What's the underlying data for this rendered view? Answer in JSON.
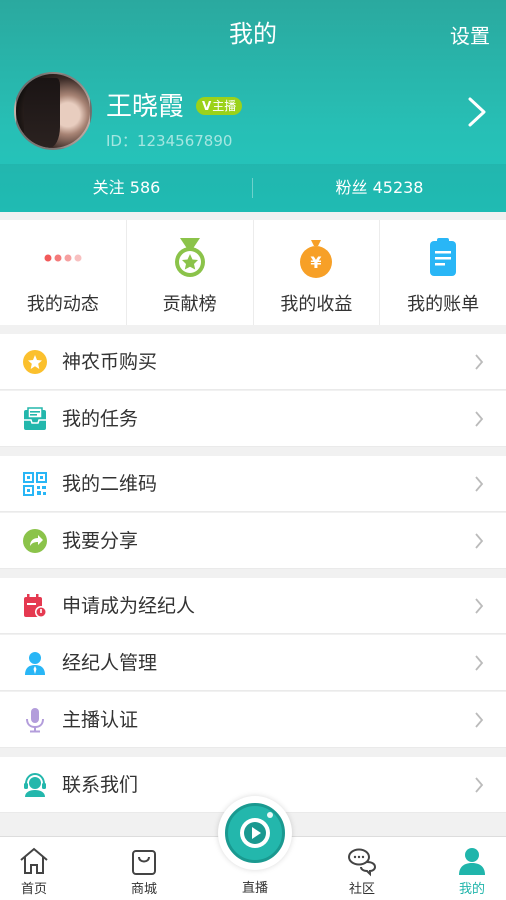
{
  "header": {
    "title": "我的",
    "settings_label": "设置"
  },
  "profile": {
    "name": "王晓霞",
    "badge_label": "主播",
    "badge_prefix": "V",
    "id_text": "ID：1234567890"
  },
  "stats": {
    "follow": "关注  586",
    "fans": "粉丝  45238"
  },
  "quick_actions": [
    {
      "label": "我的动态",
      "icon": "dots-icon"
    },
    {
      "label": "贡献榜",
      "icon": "medal-icon"
    },
    {
      "label": "我的收益",
      "icon": "money-bag-icon"
    },
    {
      "label": "我的账单",
      "icon": "clipboard-icon"
    }
  ],
  "menu": [
    {
      "label": "神农币购买",
      "icon": "coin-star-icon"
    },
    {
      "label": "我的任务",
      "icon": "task-tray-icon"
    },
    {
      "label": "我的二维码",
      "icon": "qr-code-icon"
    },
    {
      "label": "我要分享",
      "icon": "share-icon"
    },
    {
      "label": "申请成为经纪人",
      "icon": "calendar-apply-icon"
    },
    {
      "label": "经纪人管理",
      "icon": "person-manage-icon"
    },
    {
      "label": "主播认证",
      "icon": "microphone-icon"
    },
    {
      "label": "联系我们",
      "icon": "headset-icon"
    }
  ],
  "tabbar": [
    {
      "label": "首页",
      "icon": "home-icon"
    },
    {
      "label": "商城",
      "icon": "shopping-bag-icon"
    },
    {
      "label": "直播",
      "icon": "play-icon"
    },
    {
      "label": "社区",
      "icon": "chat-bubbles-icon"
    },
    {
      "label": "我的",
      "icon": "user-icon",
      "active": true
    }
  ],
  "colors": {
    "accent": "#22c7bf",
    "badge": "#9bd21a",
    "active_tab": "#20b5ab"
  }
}
